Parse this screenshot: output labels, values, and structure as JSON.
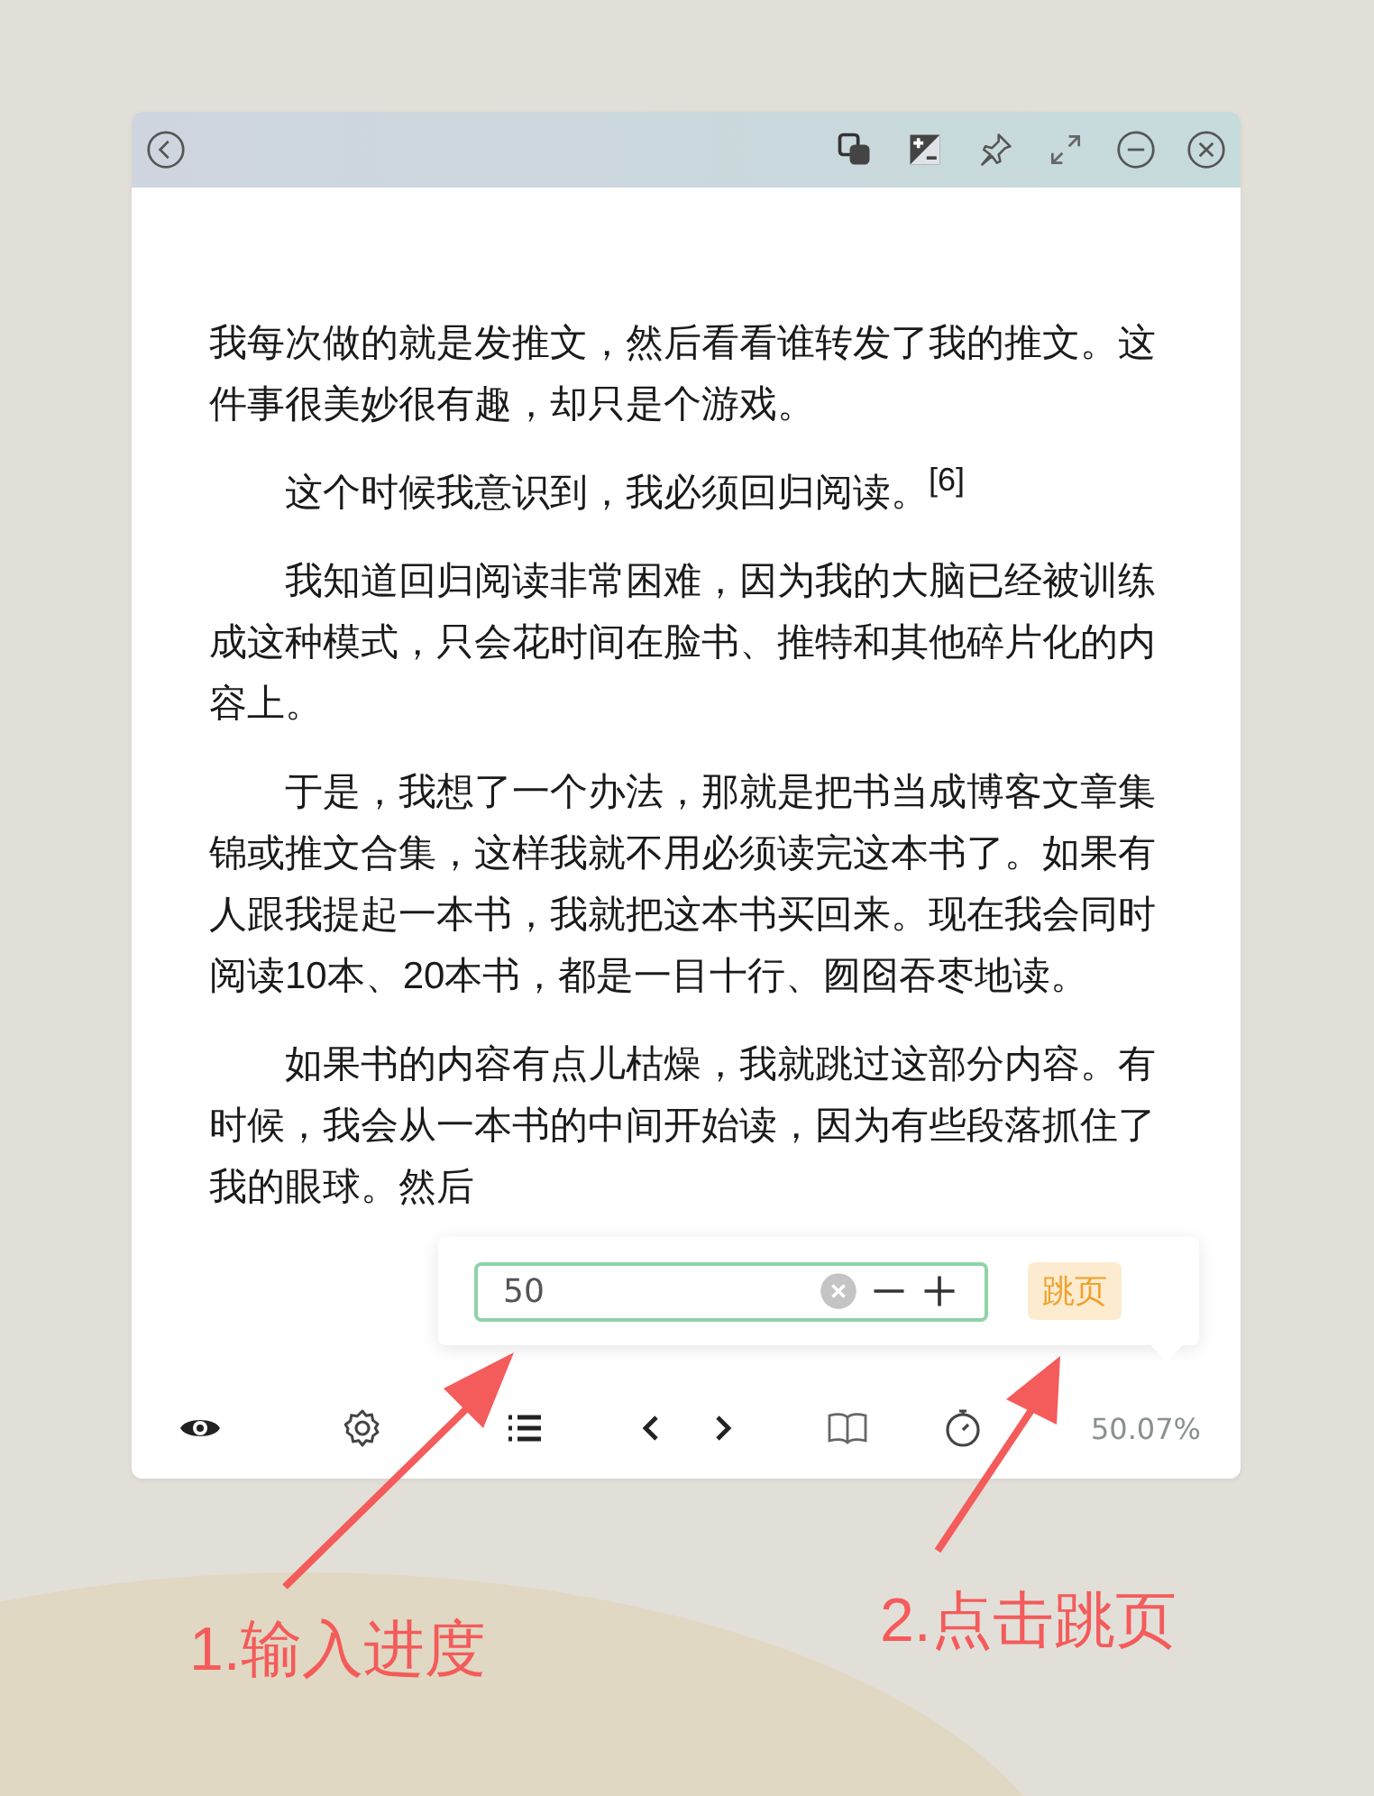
{
  "reader": {
    "paragraphs": [
      {
        "kind": "continued",
        "text": "我每次做的就是发推文，然后看看谁转发了我的推文。这件事很美妙很有趣，却只是个游戏。"
      },
      {
        "kind": "indented",
        "text": "这个时候我意识到，我必须回归阅读。$^{[6]}$"
      },
      {
        "kind": "indented",
        "text": "我知道回归阅读非常困难，因为我的大脑已经被训练成这种模式，只会花时间在脸书、推特和其他碎片化的内容上。"
      },
      {
        "kind": "indented",
        "text": "于是，我想了一个办法，那就是把书当成博客文章集锦或推文合集，这样我就不用必须读完这本书了。如果有人跟我提起一本书，我就把这本书买回来。现在我会同时阅读10本、20本书，都是一目十行、囫囵吞枣地读。"
      },
      {
        "kind": "indented",
        "text": "如果书的内容有点儿枯燥，我就跳过这部分内容。有时候，我会从一本书的中间开始读，因为有些段落抓住了我的眼球。然后"
      }
    ]
  },
  "jump_popup": {
    "value": "50",
    "button": "跳页"
  },
  "toolbar": {
    "progress": "50.07%"
  },
  "annotations": [
    {
      "text": "1.输入进度"
    },
    {
      "text": "2.点击跳页"
    }
  ]
}
